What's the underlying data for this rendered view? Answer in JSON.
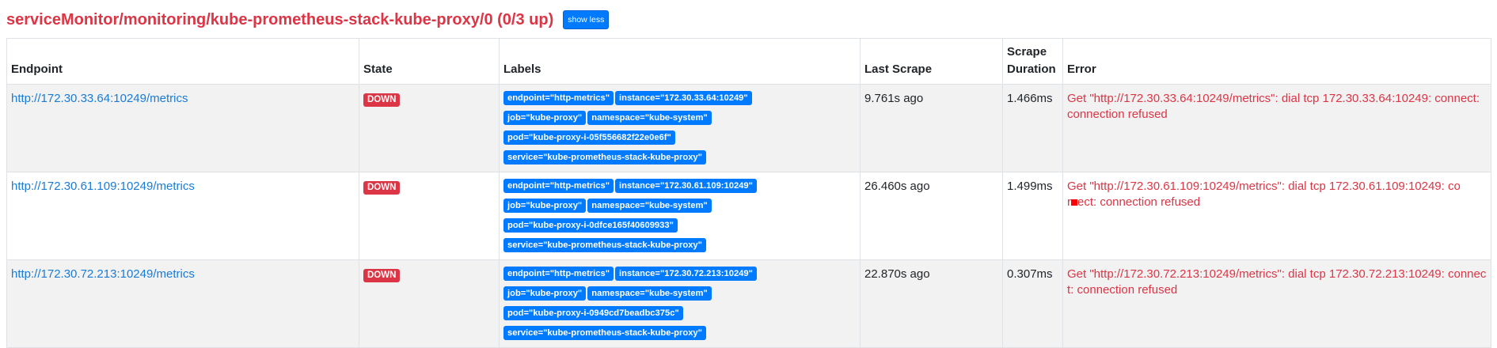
{
  "header": {
    "title": "serviceMonitor/monitoring/kube-prometheus-stack-kube-proxy/0 (0/3 up)",
    "toggle_label": "show less"
  },
  "columns": [
    "Endpoint",
    "State",
    "Labels",
    "Last Scrape",
    "Scrape Duration",
    "Error"
  ],
  "rows": [
    {
      "endpoint": "http://172.30.33.64:10249/metrics",
      "state": "DOWN",
      "labels": [
        "endpoint=\"http-metrics\"",
        "instance=\"172.30.33.64:10249\"",
        "job=\"kube-proxy\"",
        "namespace=\"kube-system\"",
        "pod=\"kube-proxy-i-05f556682f22e0e6f\"",
        "service=\"kube-prometheus-stack-kube-proxy\""
      ],
      "last_scrape": "9.761s ago",
      "duration": "1.466ms",
      "error_a": "Get \"http://172.30.33.64:10249/metrics\": dial tcp 172.30.33.64:10249: connect: connection refused",
      "error_b": ""
    },
    {
      "endpoint": "http://172.30.61.109:10249/metrics",
      "state": "DOWN",
      "labels": [
        "endpoint=\"http-metrics\"",
        "instance=\"172.30.61.109:10249\"",
        "job=\"kube-proxy\"",
        "namespace=\"kube-system\"",
        "pod=\"kube-proxy-i-0dfce165f40609933\"",
        "service=\"kube-prometheus-stack-kube-proxy\""
      ],
      "last_scrape": "26.460s ago",
      "duration": "1.499ms",
      "error_a": "Get \"http://172.30.61.109:10249/metrics\": dial tcp 172.30.61.109:10249: co",
      "error_b": "ect: connection refused"
    },
    {
      "endpoint": "http://172.30.72.213:10249/metrics",
      "state": "DOWN",
      "labels": [
        "endpoint=\"http-metrics\"",
        "instance=\"172.30.72.213:10249\"",
        "job=\"kube-proxy\"",
        "namespace=\"kube-system\"",
        "pod=\"kube-proxy-i-0949cd7beadbc375c\"",
        "service=\"kube-prometheus-stack-kube-proxy\""
      ],
      "last_scrape": "22.870s ago",
      "duration": "0.307ms",
      "error_a": "Get \"http://172.30.72.213:10249/metrics\": dial tcp 172.30.72.213:10249: connect: connection refused",
      "error_b": ""
    }
  ],
  "colors": {
    "danger": "#dc3545",
    "primary": "#007bff",
    "link": "#1a7bd7",
    "row_alt": "#f2f2f2"
  }
}
